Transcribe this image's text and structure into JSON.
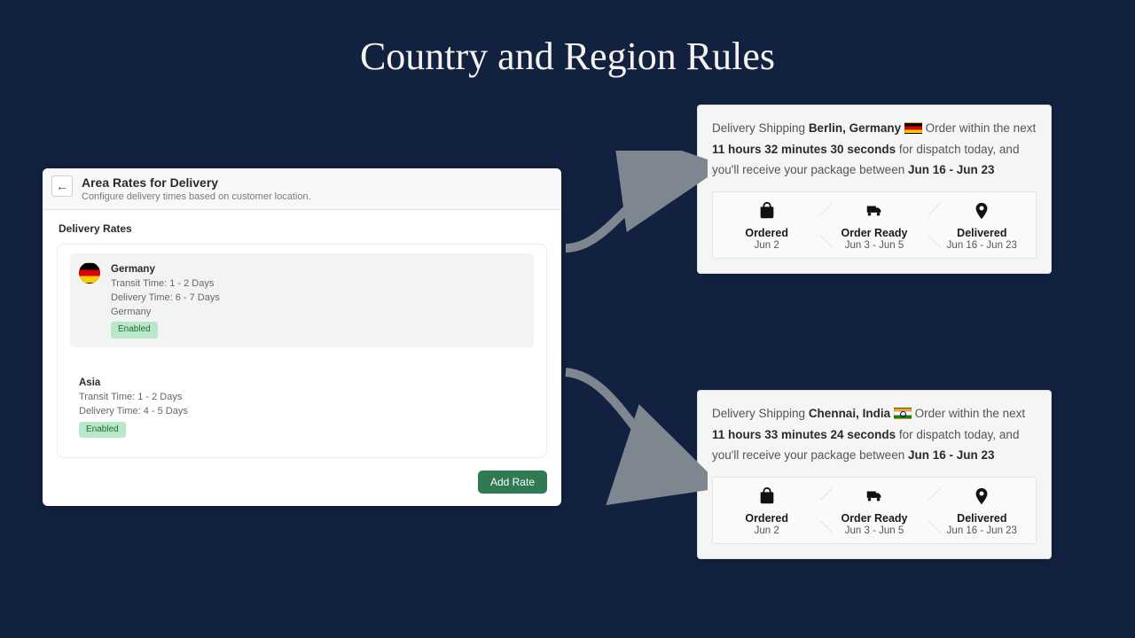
{
  "title": "Country and Region Rules",
  "admin": {
    "heading": "Area Rates for Delivery",
    "sub": "Configure delivery times based on customer location.",
    "section": "Delivery Rates",
    "rates": [
      {
        "name": "Germany",
        "transit": "Transit Time: 1 - 2 Days",
        "delivery": "Delivery Time: 6 - 7 Days",
        "region_line": "Germany",
        "badge": "Enabled",
        "selected": true,
        "has_flag": true
      },
      {
        "name": "Asia",
        "transit": "Transit Time: 1 - 2 Days",
        "delivery": "Delivery Time: 4 - 5 Days",
        "region_line": "",
        "badge": "Enabled",
        "selected": false,
        "has_flag": false
      }
    ],
    "add_btn": "Add Rate"
  },
  "estimates": [
    {
      "prefix": "Delivery Shipping ",
      "location": "Berlin, Germany",
      "flag": "de",
      "mid1": "  Order within the next ",
      "countdown": "11 hours 32 minutes 30 seconds",
      "mid2": " for dispatch today, and you'll receive your package between ",
      "range": "Jun 16 - Jun 23",
      "steps": [
        {
          "title": "Ordered",
          "date": "Jun 2"
        },
        {
          "title": "Order Ready",
          "date": "Jun 3 - Jun 5"
        },
        {
          "title": "Delivered",
          "date": "Jun 16 - Jun 23"
        }
      ]
    },
    {
      "prefix": "Delivery Shipping ",
      "location": "Chennai, India",
      "flag": "in",
      "mid1": "  Order within the next ",
      "countdown": "11 hours 33 minutes 24 seconds",
      "mid2": " for dispatch today, and you'll receive your package between ",
      "range": "Jun 16 - Jun 23",
      "steps": [
        {
          "title": "Ordered",
          "date": "Jun 2"
        },
        {
          "title": "Order Ready",
          "date": "Jun 3 - Jun 5"
        },
        {
          "title": "Delivered",
          "date": "Jun 16 - Jun 23"
        }
      ]
    }
  ]
}
